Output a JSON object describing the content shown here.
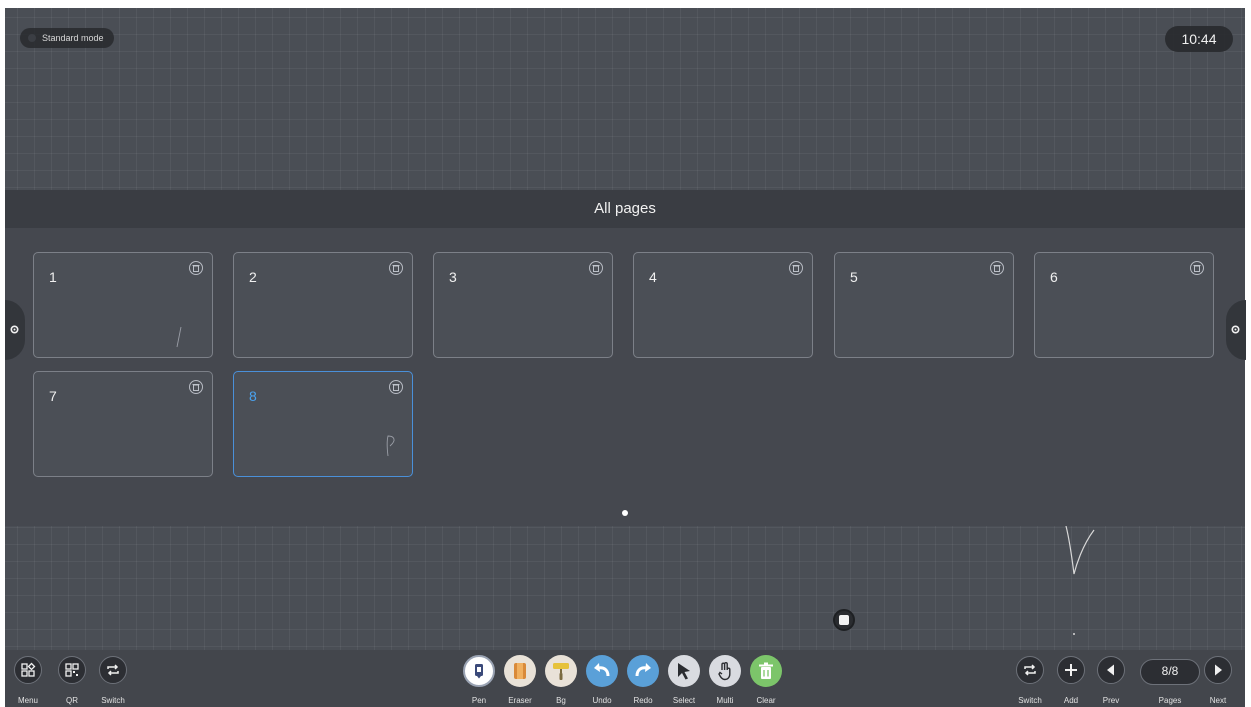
{
  "status": {
    "mode_label": "Standard mode",
    "clock": "10:44"
  },
  "overview": {
    "title": "All pages",
    "pages": [
      {
        "number": "1",
        "active": false
      },
      {
        "number": "2",
        "active": false
      },
      {
        "number": "3",
        "active": false
      },
      {
        "number": "4",
        "active": false
      },
      {
        "number": "5",
        "active": false
      },
      {
        "number": "6",
        "active": false
      },
      {
        "number": "7",
        "active": false
      },
      {
        "number": "8",
        "active": true
      }
    ]
  },
  "toolbar": {
    "left": {
      "menu": "Menu",
      "qr": "QR",
      "switch": "Switch"
    },
    "tools": {
      "pen": "Pen",
      "eraser": "Eraser",
      "bg": "Bg",
      "undo": "Undo",
      "redo": "Redo",
      "select": "Select",
      "multi": "Multi",
      "clear": "Clear"
    },
    "right": {
      "switch": "Switch",
      "add": "Add",
      "prev": "Prev",
      "pages": "Pages",
      "next": "Next",
      "page_indicator": "8/8"
    }
  },
  "colors": {
    "accent": "#4aa3f0",
    "clear_green": "#7cc56a",
    "undo_blue": "#5aa0d8",
    "bg_yellow": "#e6c23a"
  },
  "icons": {
    "menu": "menu-grid-icon",
    "qr": "qr-icon",
    "switch": "switch-arrows-icon",
    "add": "plus-icon",
    "prev": "chevron-left-icon",
    "next": "chevron-right-icon",
    "delete": "trash-icon"
  }
}
